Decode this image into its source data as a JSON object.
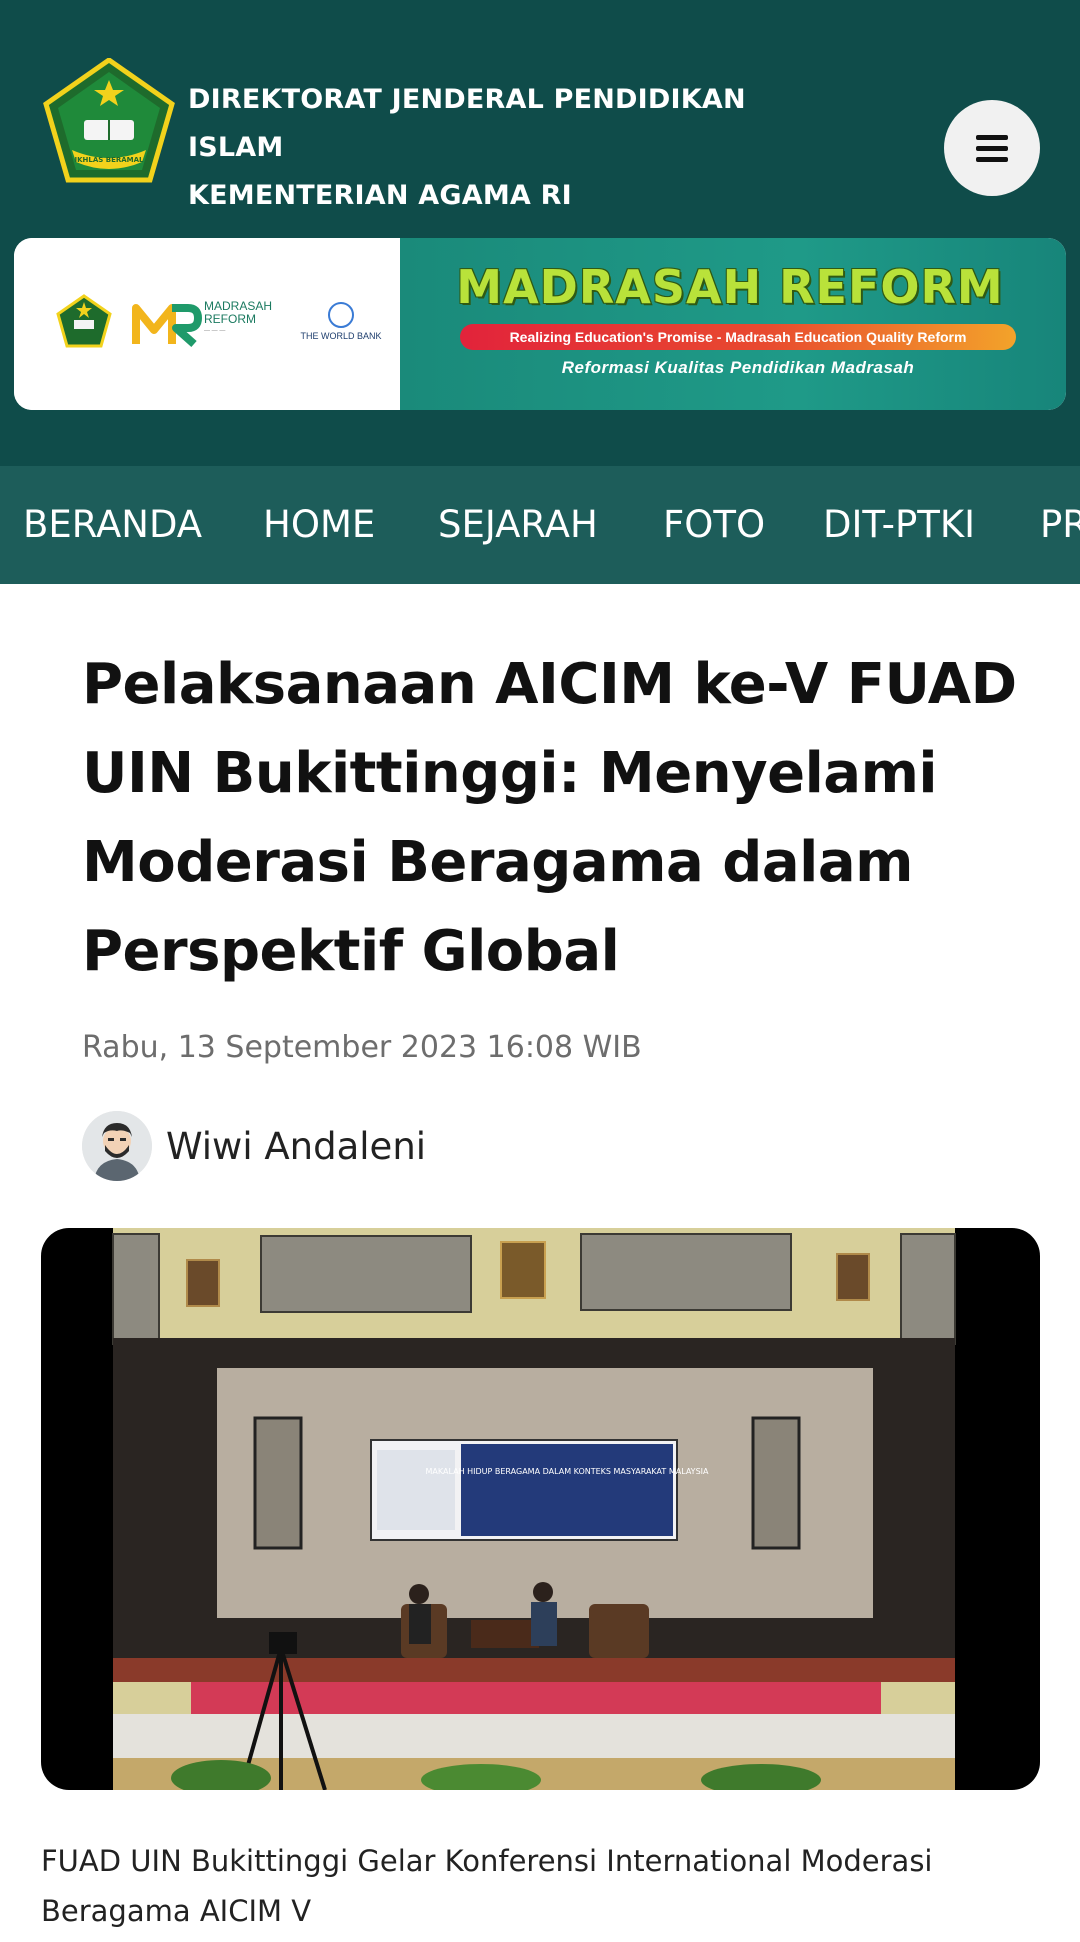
{
  "header": {
    "org_title_line1": "DIREKTORAT JENDERAL PENDIDIKAN ISLAM",
    "org_title_line2": "KEMENTERIAN AGAMA RI",
    "logo_icon": "kemenag-emblem-icon",
    "menu_icon": "hamburger-menu-icon",
    "colors": {
      "background": "#0f4c4a",
      "nav": "#1d5d5a"
    }
  },
  "banner": {
    "mr_logo_text": "MADRASAH REFORM",
    "world_bank_text": "THE WORLD BANK",
    "title": "MADRASAH REFORM",
    "ribbon": "Realizing Education's Promise - Madrasah Education Quality Reform",
    "tagline": "Reformasi Kualitas Pendidikan Madrasah"
  },
  "nav": {
    "items": [
      {
        "label": "BERANDA"
      },
      {
        "label": "HOME"
      },
      {
        "label": "SEJARAH"
      },
      {
        "label": "FOTO"
      },
      {
        "label": "DIT-PTKI"
      },
      {
        "label": "PR"
      }
    ]
  },
  "article": {
    "title": "Pelaksanaan AICIM ke-V FUAD UIN Bukittinggi: Menyelami Moderasi Beragama dalam Perspektif Global",
    "date": "Rabu, 13 September 2023 16:08 WIB",
    "author": "Wiwi Andaleni",
    "photo_screen_title": "MAKALAH HIDUP BERAGAMA DALAM KONTEKS MASYARAKAT MALAYSIA",
    "caption": "FUAD UIN Bukittinggi Gelar Konferensi International Moderasi Beragama AICIM V"
  }
}
